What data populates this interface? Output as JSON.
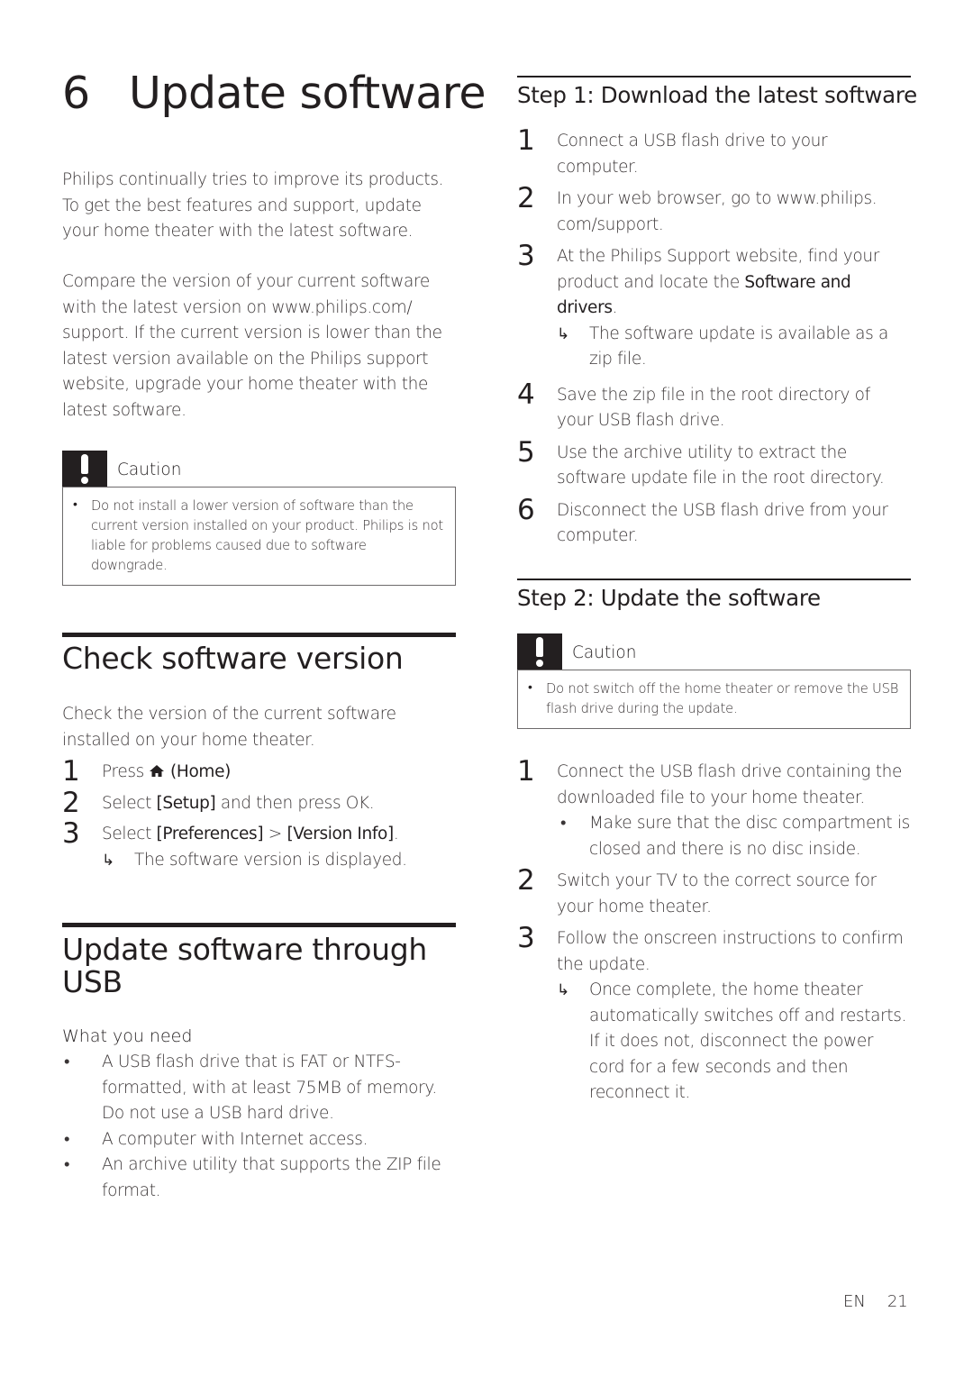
{
  "chapter": {
    "number": "6",
    "title": "Update software"
  },
  "intro": {
    "para1": "Philips continually tries to improve its products. To get the best features and support, update your home theater with the latest software.",
    "para2": "Compare the version of your current software with the latest version on www.philips.com/ support. If the current version is lower than the latest version available on the Philips support website, upgrade your home theater with the latest software."
  },
  "caution1": {
    "icon": "exclamation-icon",
    "label": "Caution",
    "text": "Do not install a lower version of software than the current version installed on your product. Philips is not liable for problems caused due to software downgrade."
  },
  "check_version": {
    "title": "Check software version",
    "intro": "Check the version of the current software installed on your home theater.",
    "steps": [
      {
        "num": "1",
        "pre": "Press",
        "icon": "home-icon",
        "bold": "(Home)",
        "post": "."
      },
      {
        "num": "2",
        "pre": "Select",
        "bold": "[Setup]",
        "post": "and then press OK."
      },
      {
        "num": "3",
        "pre": "Select",
        "bold": "[Preferences]",
        "mid": ">",
        "bold2": "[Version Info]",
        "post": ".",
        "result": "The software version is displayed."
      }
    ]
  },
  "usb_section": {
    "title_line1": "Update software through",
    "title_line2": "USB",
    "need_title": "What you need",
    "needs": [
      "A USB flash drive that is FAT or NTFS-formatted, with at least 75MB of memory. Do not use a USB hard drive.",
      "A computer with Internet access.",
      "An archive utility that supports the ZIP file format."
    ]
  },
  "step1": {
    "title": "Step 1: Download the latest software",
    "steps": [
      {
        "num": "1",
        "text": "Connect a USB flash drive to your computer."
      },
      {
        "num": "2",
        "text": "In your web browser, go to www.philips. com/support."
      },
      {
        "num": "3",
        "pre": "At the Philips Support website, find your product and locate the",
        "bold": "Software and drivers",
        "post": ".",
        "result": "The software update is available as a zip file."
      },
      {
        "num": "4",
        "text": "Save the zip file in the root directory of your USB flash drive."
      },
      {
        "num": "5",
        "text": "Use the archive utility to extract the software update file in the root directory."
      },
      {
        "num": "6",
        "text": "Disconnect the USB flash drive from your computer."
      }
    ]
  },
  "step2": {
    "title": "Step 2: Update the software",
    "caution": {
      "icon": "exclamation-icon",
      "label": "Caution",
      "text": "Do not switch off the home theater or remove the USB flash drive during the update."
    },
    "steps": [
      {
        "num": "1",
        "text": "Connect the USB flash drive containing the downloaded file to your home theater.",
        "bullet": "Make sure that the disc compartment is closed and there is no disc inside."
      },
      {
        "num": "2",
        "text": "Switch your TV to the correct source for your home theater."
      },
      {
        "num": "3",
        "text": "Follow the onscreen instructions to confirm the update.",
        "result": "Once complete, the home theater automatically switches off and restarts. If it does not, disconnect the power cord for a few seconds and then reconnect it."
      }
    ]
  },
  "footer": {
    "lang": "EN",
    "page": "21"
  },
  "glyphs": {
    "bullet": "•",
    "arrow": "↳"
  }
}
